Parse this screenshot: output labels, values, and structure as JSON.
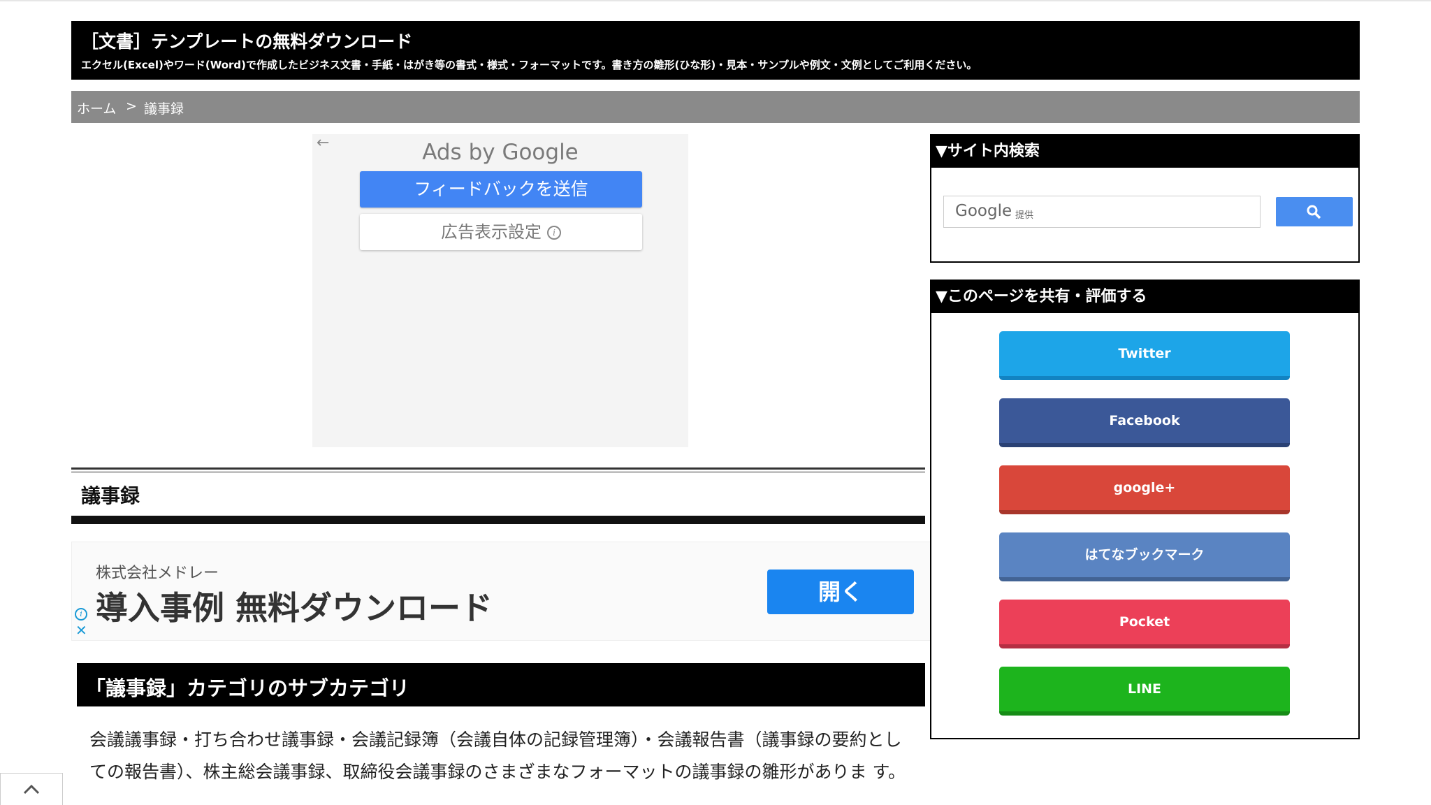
{
  "header": {
    "title": "［文書］テンプレートの無料ダウンロード",
    "description": "エクセル(Excel)やワード(Word)で作成したビジネス文書・手紙・はがき等の書式・様式・フォーマットです。書き方の雛形(ひな形)・見本・サンプルや例文・文例としてご利用ください。"
  },
  "breadcrumb": {
    "home": "ホーム",
    "separator": ">",
    "current": "議事録"
  },
  "ad_top": {
    "back_icon": "arrow-left-icon",
    "ads_by": "Ads by Google",
    "feedback_button": "フィードバックを送信",
    "settings_button": "広告表示設定",
    "info_icon": "info-icon"
  },
  "main": {
    "section_title": "議事録",
    "subcategory_heading": "「議事録」カテゴリのサブカテゴリ",
    "body_text": "会議議事録・打ち合わせ議事録・会議記録簿（会議自体の記録管理簿）・会議報告書（議事録の要約としての報告書）、株主総会議事録、取締役会議事録のさまざまなフォーマットの議事録の雛形がありま す。"
  },
  "ad_banner": {
    "advertiser": "株式会社メドレー",
    "headline": "導入事例 無料ダウンロード",
    "open_button": "開く",
    "info_icon": "info-icon",
    "close_icon": "close-icon"
  },
  "sidebar": {
    "search_widget": {
      "title": "▼サイト内検索",
      "google_label": "Google",
      "provided_label": "提供",
      "search_icon": "search-icon"
    },
    "share_widget": {
      "title": "▼このページを共有・評価する",
      "buttons": [
        {
          "label": "Twitter",
          "color": "#1da5e8",
          "shade": "#1283c2"
        },
        {
          "label": "Facebook",
          "color": "#3b5898",
          "shade": "#2a4174"
        },
        {
          "label": "google+",
          "color": "#d9473a",
          "shade": "#a8362b"
        },
        {
          "label": "はてなブックマーク",
          "color": "#5a84c2",
          "shade": "#426394"
        },
        {
          "label": "Pocket",
          "color": "#ec4058",
          "shade": "#b52f43"
        },
        {
          "label": "LINE",
          "color": "#1db41d",
          "shade": "#168c16"
        }
      ]
    }
  },
  "scroll_top": {
    "icon": "chevron-up-icon"
  }
}
